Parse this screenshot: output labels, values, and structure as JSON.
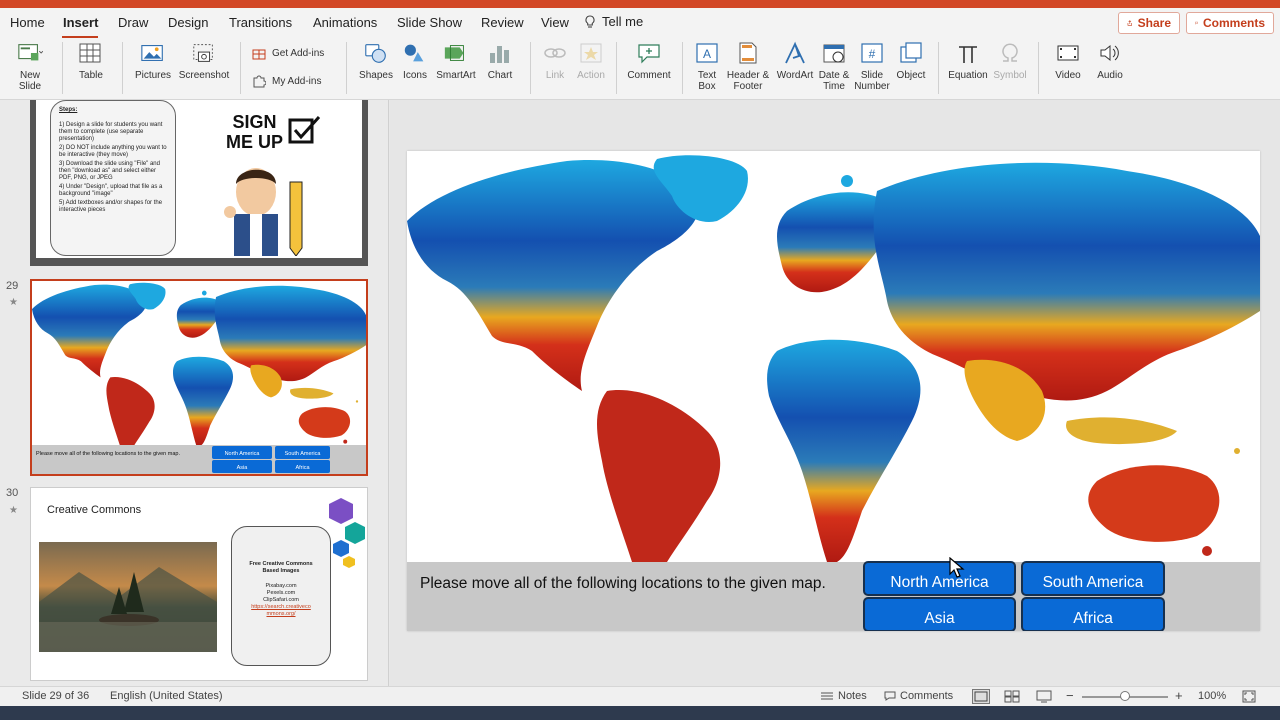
{
  "colors": {
    "accent": "#c43e1c",
    "location_button": "#0a6ad6",
    "bar": "#c8c8c8"
  },
  "tabs": [
    "Home",
    "Insert",
    "Draw",
    "Design",
    "Transitions",
    "Animations",
    "Slide Show",
    "Review",
    "View"
  ],
  "tell_me": "Tell me",
  "share_label": "Share",
  "comments_label": "Comments",
  "ribbon": {
    "new_slide": [
      "New",
      "Slide"
    ],
    "table": "Table",
    "pictures": "Pictures",
    "screenshot": "Screenshot",
    "get_addins": "Get Add-ins",
    "my_addins": "My Add-ins",
    "shapes": "Shapes",
    "icons": "Icons",
    "smartart": "SmartArt",
    "chart": "Chart",
    "link": "Link",
    "action": "Action",
    "comment": "Comment",
    "text_box": [
      "Text",
      "Box"
    ],
    "header_footer": [
      "Header &",
      "Footer"
    ],
    "wordart": "WordArt",
    "date_time": [
      "Date &",
      "Time"
    ],
    "slide_number": [
      "Slide",
      "Number"
    ],
    "object": "Object",
    "equation": "Equation",
    "symbol": "Symbol",
    "video": "Video",
    "audio": "Audio"
  },
  "thumbs": {
    "prev": {
      "steps_title": "Steps:",
      "steps": [
        "1)  Design a slide for students you want them to complete (use separate presentation)",
        "2)  DO NOT include anything you want to be interactive (they move)",
        "3)  Download the slide using \"File\" and then \"download as\" and select either PDF, PNG, or JPEG",
        "4)  Under \"Design\", upload that file as a background \"image\"",
        "5)  Add textboxes and/or shapes for the interactive pieces"
      ],
      "sign_text": [
        "SIGN",
        "ME UP"
      ]
    },
    "slide29": {
      "number": "29",
      "prompt": "Please move all of the following locations to the given map.",
      "buttons": [
        "North America",
        "South America",
        "Asia",
        "Africa"
      ]
    },
    "slide30": {
      "number": "30",
      "title": "Creative Commons",
      "box_title": [
        "Free Creative Commons",
        "Based Images"
      ],
      "sites": [
        "Pixabay.com",
        "Pexels.com",
        "ClipSafari.com"
      ],
      "link": [
        "https://search.creativeco",
        "mmons.org/"
      ]
    }
  },
  "slide": {
    "prompt": "Please move all of the following locations to the given map.",
    "locations": [
      "North America",
      "South America",
      "Asia",
      "Africa"
    ]
  },
  "status": {
    "slide_of": "Slide 29 of 36",
    "language": "English (United States)",
    "notes": "Notes",
    "comments": "Comments",
    "zoom": "100%"
  }
}
